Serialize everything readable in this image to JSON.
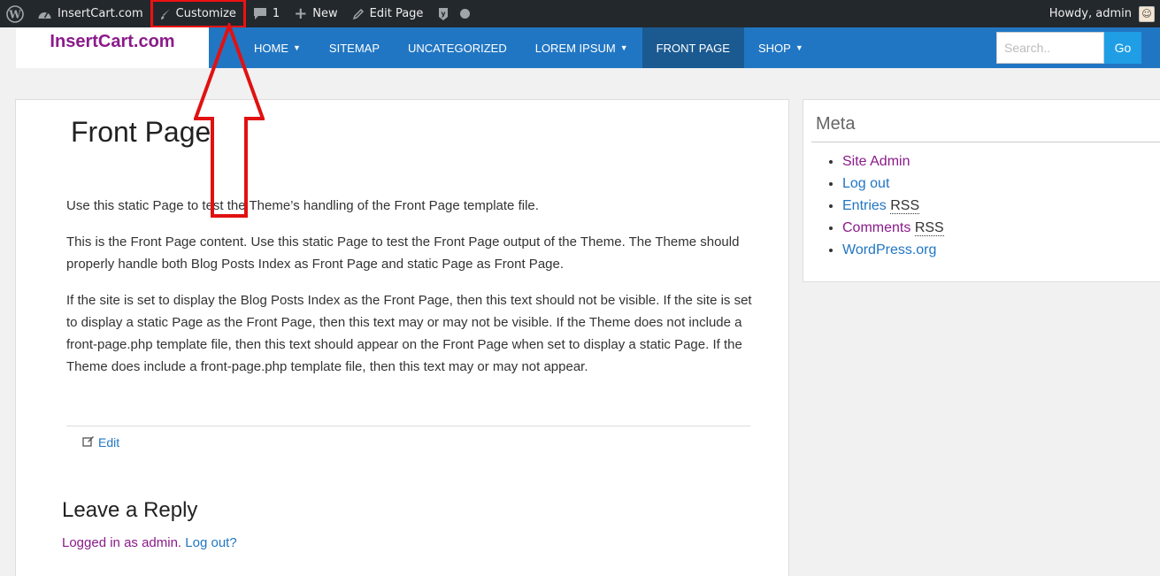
{
  "adminbar": {
    "site_name": "InsertCart.com",
    "customize": "Customize",
    "comments_count": "1",
    "new_label": "New",
    "edit_page": "Edit Page",
    "howdy": "Howdy, admin"
  },
  "nav": {
    "brand": "InsertCart.com",
    "items": [
      {
        "label": "HOME",
        "dropdown": true
      },
      {
        "label": "SITEMAP",
        "dropdown": false
      },
      {
        "label": "UNCATEGORIZED",
        "dropdown": false
      },
      {
        "label": "LOREM IPSUM",
        "dropdown": true
      },
      {
        "label": "FRONT PAGE",
        "dropdown": false,
        "active": true
      },
      {
        "label": "SHOP",
        "dropdown": true
      }
    ],
    "search_placeholder": "Search..",
    "search_button": "Go"
  },
  "main": {
    "title": "Front Page",
    "paragraphs": [
      "Use this static Page to test the Theme’s handling of the Front Page template file.",
      "This is the Front Page content. Use this static Page to test the Front Page output of the Theme. The Theme should properly handle both Blog Posts Index as Front Page and static Page as Front Page.",
      "If the site is set to display the Blog Posts Index as the Front Page, then this text should not be visible. If the site is set to display a static Page as the Front Page, then this text may or may not be visible. If the Theme does not include a front-page.php template file, then this text should appear on the Front Page when set to display a static Page. If the Theme does include a front-page.php template file, then this text may or may not appear."
    ],
    "edit_label": "Edit",
    "reply_title": "Leave a Reply",
    "logged_in": "Logged in as admin.",
    "logout": "Log out?"
  },
  "sidebar": {
    "title": "Meta",
    "links": {
      "site_admin": "Site Admin",
      "log_out": "Log out",
      "entries": "Entries",
      "comments": "Comments",
      "rss": "RSS",
      "wordpress": "WordPress.org"
    }
  },
  "colors": {
    "adminbar": "#23282d",
    "nav": "#2176c3",
    "nav_active": "#1b5a91",
    "brand": "#8b1a8b",
    "link": "#2176c3",
    "visited_link": "#8b1a8b",
    "annotation": "#e11111"
  }
}
